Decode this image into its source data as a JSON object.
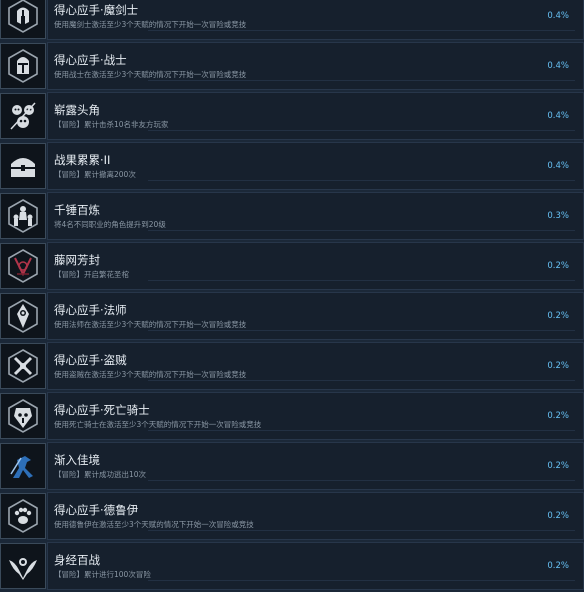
{
  "achievements": [
    {
      "title": "得心应手·魔剑士",
      "desc": "使用魔剑士激活至少3个天赋的情况下开始一次冒险或竞技",
      "pct": "0.4%",
      "icon": "helmet-icon"
    },
    {
      "title": "得心应手·战士",
      "desc": "使用战士在激活至少3个天赋的情况下开始一次冒险或竞技",
      "pct": "0.4%",
      "icon": "knight-helmet-icon"
    },
    {
      "title": "崭露头角",
      "desc": "【冒险】累计击杀10名非友方玩家",
      "pct": "0.4%",
      "icon": "skulls-icon"
    },
    {
      "title": "战果累累·II",
      "desc": "【冒险】累计撤离200次",
      "pct": "0.4%",
      "icon": "treasure-chest-icon"
    },
    {
      "title": "千锤百炼",
      "desc": "将4名不同职业的角色提升到20级",
      "pct": "0.3%",
      "icon": "party-icon"
    },
    {
      "title": "藤网芳封",
      "desc": "【冒险】开启繁花圣棺",
      "pct": "0.2%",
      "icon": "thorn-sigil-icon"
    },
    {
      "title": "得心应手·法师",
      "desc": "使用法师在激活至少3个天赋的情况下开始一次冒险或竞技",
      "pct": "0.2%",
      "icon": "mage-icon"
    },
    {
      "title": "得心应手·盗贼",
      "desc": "使用盗贼在激活至少3个天赋的情况下开始一次冒险或竞技",
      "pct": "0.2%",
      "icon": "crossed-daggers-icon"
    },
    {
      "title": "得心应手·死亡骑士",
      "desc": "使用死亡骑士在激活至少3个天赋的情况下开始一次冒险或竞技",
      "pct": "0.2%",
      "icon": "death-knight-icon"
    },
    {
      "title": "渐入佳境",
      "desc": "【冒险】累计成功逃出10次",
      "pct": "0.2%",
      "icon": "runner-icon"
    },
    {
      "title": "得心应手·德鲁伊",
      "desc": "使用德鲁伊在激活至少3个天赋的情况下开始一次冒险或竞技",
      "pct": "0.2%",
      "icon": "paw-icon"
    },
    {
      "title": "身经百战",
      "desc": "【冒险】累计进行100次冒险",
      "pct": "0.2%",
      "icon": "winged-emblem-icon"
    }
  ]
}
